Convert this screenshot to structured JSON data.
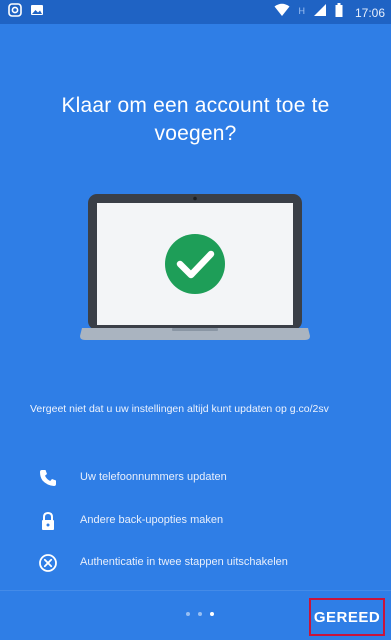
{
  "status_bar": {
    "time": "17:06",
    "network_label": "H",
    "icons": [
      "instagram-icon",
      "image-icon",
      "wifi-icon",
      "signal-icon",
      "battery-icon"
    ]
  },
  "main": {
    "title": "Klaar om een account toe te voegen?",
    "illustration": "laptop-check-icon",
    "reminder": "Vergeet niet dat u uw instellingen altijd kunt updaten op g.co/2sv",
    "options": [
      {
        "icon": "phone-icon",
        "label": "Uw telefoonnummers updaten"
      },
      {
        "icon": "lock-icon",
        "label": "Andere back-upopties maken"
      },
      {
        "icon": "close-circle-icon",
        "label": "Authenticatie in twee stappen uitschakelen"
      }
    ]
  },
  "footer": {
    "page_count": 3,
    "active_page": 3,
    "done_label": "GEREED"
  },
  "colors": {
    "background": "#2f7ee6",
    "status_bar": "#1f63c4",
    "check_green": "#1e9e58",
    "highlight": "#c9143a"
  }
}
